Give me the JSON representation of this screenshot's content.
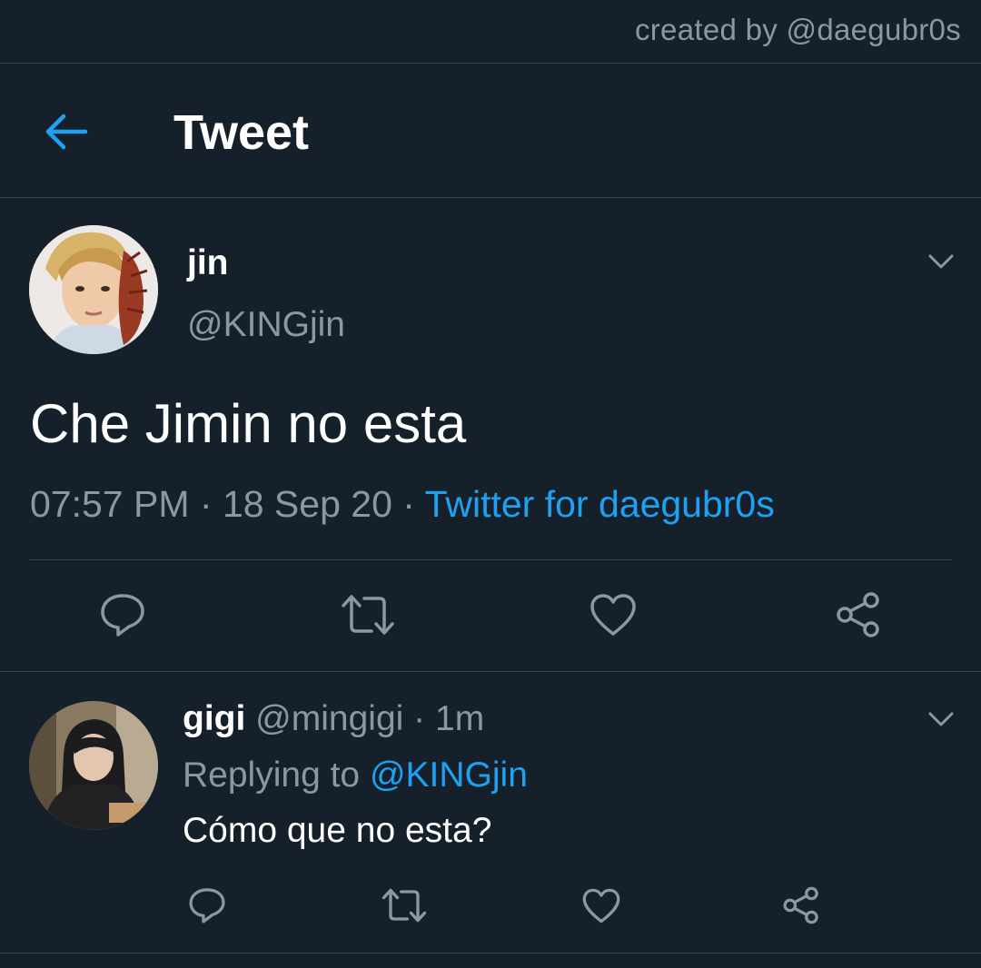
{
  "watermark": "created by @daegubr0s",
  "header": {
    "title": "Tweet",
    "back_icon": "arrow-left-icon",
    "accent_color": "#1da1f2"
  },
  "main_tweet": {
    "display_name": "jin",
    "handle": "@KINGjin",
    "text": "Che Jimin no esta",
    "time": "07:57 PM",
    "date": "18 Sep 20",
    "separator": " · ",
    "source": "Twitter for daegubr0s",
    "actions": [
      "reply-icon",
      "retweet-icon",
      "like-icon",
      "share-icon"
    ]
  },
  "reply_tweet": {
    "display_name": "gigi",
    "handle": "@mingigi",
    "separator": " · ",
    "age": "1m",
    "replying_prefix": "Replying to ",
    "replying_to": "@KINGjin",
    "text": "Cómo que no esta?",
    "actions": [
      "reply-icon",
      "retweet-icon",
      "like-icon",
      "share-icon"
    ]
  },
  "colors": {
    "background": "#15202b",
    "secondary_text": "#8899a6",
    "divider": "#38444d"
  }
}
